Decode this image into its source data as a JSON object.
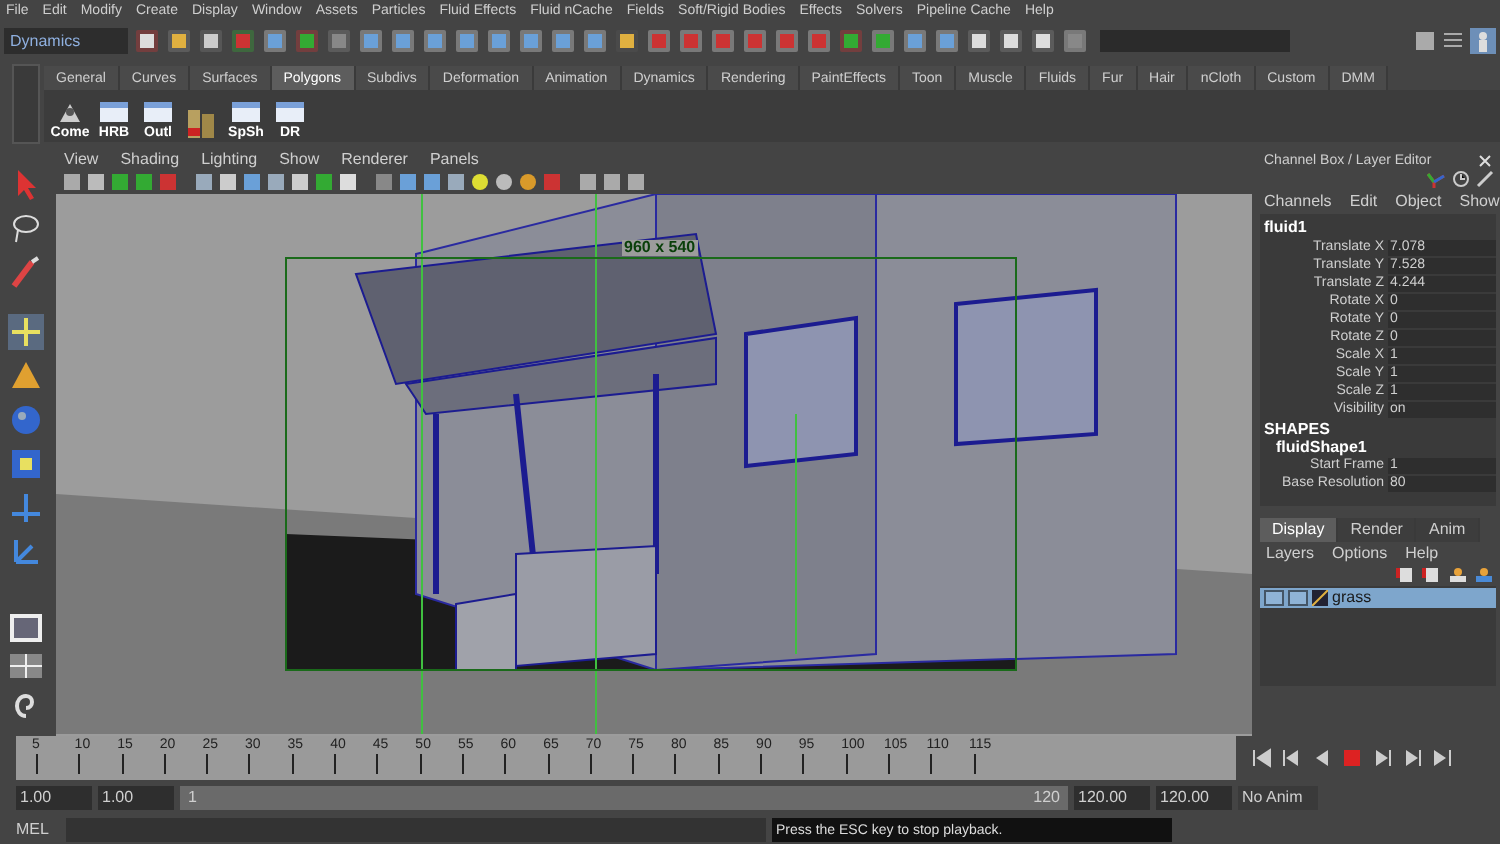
{
  "menu_bar": [
    "File",
    "Edit",
    "Modify",
    "Create",
    "Display",
    "Window",
    "Assets",
    "Particles",
    "Fluid Effects",
    "Fluid nCache",
    "Fields",
    "Soft/Rigid Bodies",
    "Effects",
    "Solvers",
    "Pipeline Cache",
    "Help"
  ],
  "status_line": {
    "mode": "Dynamics"
  },
  "shelf": {
    "tabs": [
      {
        "label": "General",
        "selected": false
      },
      {
        "label": "Curves",
        "selected": false
      },
      {
        "label": "Surfaces",
        "selected": false
      },
      {
        "label": "Polygons",
        "selected": true
      },
      {
        "label": "Subdivs",
        "selected": false
      },
      {
        "label": "Deformation",
        "selected": false
      },
      {
        "label": "Animation",
        "selected": false
      },
      {
        "label": "Dynamics",
        "selected": false
      },
      {
        "label": "Rendering",
        "selected": false
      },
      {
        "label": "PaintEffects",
        "selected": false
      },
      {
        "label": "Toon",
        "selected": false
      },
      {
        "label": "Muscle",
        "selected": false
      },
      {
        "label": "Fluids",
        "selected": false
      },
      {
        "label": "Fur",
        "selected": false
      },
      {
        "label": "Hair",
        "selected": false
      },
      {
        "label": "nCloth",
        "selected": false
      },
      {
        "label": "Custom",
        "selected": false
      },
      {
        "label": "DMM",
        "selected": false
      }
    ],
    "buttons": [
      {
        "kind": "script",
        "label": "Come"
      },
      {
        "kind": "window",
        "label": "HRB"
      },
      {
        "kind": "window",
        "label": "Outl"
      },
      {
        "kind": "cylinders"
      },
      {
        "kind": "window",
        "label": "SpSh"
      },
      {
        "kind": "window",
        "label": "DR"
      }
    ]
  },
  "viewport": {
    "menu": [
      "View",
      "Shading",
      "Lighting",
      "Show",
      "Renderer",
      "Panels"
    ],
    "resolution": "960 x 540"
  },
  "channel_box": {
    "title": "Channel Box / Layer Editor",
    "menu": [
      "Channels",
      "Edit",
      "Object",
      "Show"
    ],
    "object": "fluid1",
    "channels": [
      {
        "name": "Translate X",
        "value": "7.078"
      },
      {
        "name": "Translate Y",
        "value": "7.528"
      },
      {
        "name": "Translate Z",
        "value": "4.244"
      },
      {
        "name": "Rotate X",
        "value": "0"
      },
      {
        "name": "Rotate Y",
        "value": "0"
      },
      {
        "name": "Rotate Z",
        "value": "0"
      },
      {
        "name": "Scale X",
        "value": "1"
      },
      {
        "name": "Scale Y",
        "value": "1"
      },
      {
        "name": "Scale Z",
        "value": "1"
      },
      {
        "name": "Visibility",
        "value": "on"
      }
    ],
    "shapes_heading": "SHAPES",
    "shape": "fluidShape1",
    "shape_channels": [
      {
        "name": "Start Frame",
        "value": "1"
      },
      {
        "name": "Base Resolution",
        "value": "80"
      }
    ]
  },
  "layer_editor": {
    "tabs": [
      {
        "label": "Display",
        "selected": true
      },
      {
        "label": "Render",
        "selected": false
      },
      {
        "label": "Anim",
        "selected": false
      }
    ],
    "menu": [
      "Layers",
      "Options",
      "Help"
    ],
    "layers": [
      {
        "name": "grass",
        "selected": true
      }
    ]
  },
  "time_slider": {
    "ticks": [
      "5",
      "10",
      "15",
      "20",
      "25",
      "30",
      "35",
      "40",
      "45",
      "50",
      "55",
      "60",
      "65",
      "70",
      "75",
      "80",
      "85",
      "90",
      "95",
      "100",
      "105",
      "110",
      "115"
    ]
  },
  "range_slider": {
    "start": "1.00",
    "current_start": "1.00",
    "range_start": "1",
    "range_end": "120",
    "end": "120.00",
    "current_end": "120.00",
    "anim_layer": "No Anim",
    "level": 1
  },
  "command_line": {
    "language": "MEL",
    "feedback": "Press the ESC key to stop playback."
  }
}
